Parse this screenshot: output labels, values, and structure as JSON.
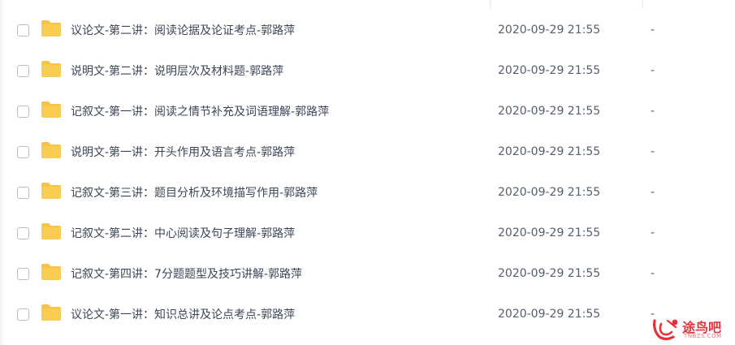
{
  "files": [
    {
      "name": "议论文-第二讲：阅读论据及论证考点-郭路萍",
      "modified": "2020-09-29 21:55",
      "size": "-"
    },
    {
      "name": "说明文-第二讲：说明层次及材料题-郭路萍",
      "modified": "2020-09-29 21:55",
      "size": "-"
    },
    {
      "name": "记叙文-第一讲：阅读之情节补充及词语理解-郭路萍",
      "modified": "2020-09-29 21:55",
      "size": "-"
    },
    {
      "name": "说明文-第一讲：开头作用及语言考点-郭路萍",
      "modified": "2020-09-29 21:55",
      "size": "-"
    },
    {
      "name": "记叙文-第三讲：题目分析及环境描写作用-郭路萍",
      "modified": "2020-09-29 21:55",
      "size": "-"
    },
    {
      "name": "记叙文-第二讲：中心阅读及句子理解-郭路萍",
      "modified": "2020-09-29 21:55",
      "size": "-"
    },
    {
      "name": "记叙文-第四讲：7分题题型及技巧讲解-郭路萍",
      "modified": "2020-09-29 21:55",
      "size": "-"
    },
    {
      "name": "议论文-第一讲：知识总讲及论点考点-郭路萍",
      "modified": "2020-09-29 21:55",
      "size": "-"
    }
  ],
  "watermark": {
    "text": "途鸟吧",
    "sub": "TNBZS.COM"
  },
  "colors": {
    "folder": "#f7c443",
    "folder_dark": "#eeb22a",
    "watermark": "#e8303a"
  },
  "icons": {
    "folder": "folder-icon",
    "checkbox": "checkbox-icon",
    "watermark_logo": "tunbao-logo-icon"
  }
}
